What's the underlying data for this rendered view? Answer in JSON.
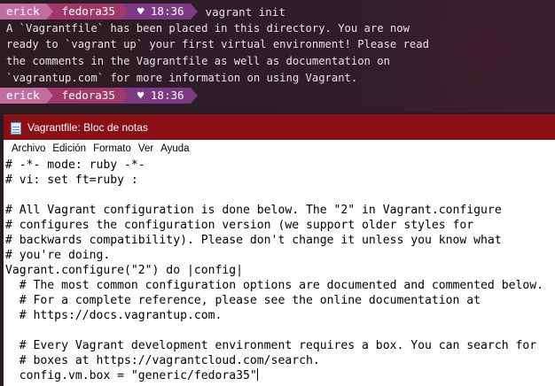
{
  "terminal": {
    "prompt1": {
      "user": "erick",
      "host": "fedora35",
      "time": "♥ 18:36",
      "command": "vagrant init"
    },
    "output": [
      "A `Vagrantfile` has been placed in this directory. You are now",
      "ready to `vagrant up` your first virtual environment! Please read",
      "the comments in the Vagrantfile as well as documentation on",
      "`vagrantup.com` for more information on using Vagrant."
    ],
    "prompt2": {
      "user": "erick",
      "host": "fedora35",
      "time": "♥ 18:36"
    }
  },
  "notepad": {
    "title": "Vagrantfile: Bloc de notas",
    "menu": [
      "Archivo",
      "Edición",
      "Formato",
      "Ver",
      "Ayuda"
    ],
    "lines": [
      "# -*- mode: ruby -*-",
      "# vi: set ft=ruby :",
      "",
      "# All Vagrant configuration is done below. The \"2\" in Vagrant.configure",
      "# configures the configuration version (we support older styles for",
      "# backwards compatibility). Please don't change it unless you know what",
      "# you're doing.",
      "Vagrant.configure(\"2\") do |config|",
      "  # The most common configuration options are documented and commented below.",
      "  # For a complete reference, please see the online documentation at",
      "  # https://docs.vagrantup.com.",
      "",
      "  # Every Vagrant development environment requires a box. You can search for",
      "  # boxes at https://vagrantcloud.com/search.",
      "  config.vm.box = \"generic/fedora35\""
    ]
  },
  "colors": {
    "titlebar": "#8b1016",
    "prompt_user": "#c26fa0",
    "prompt_host": "#a0386a",
    "prompt_time": "#7b3a83"
  }
}
